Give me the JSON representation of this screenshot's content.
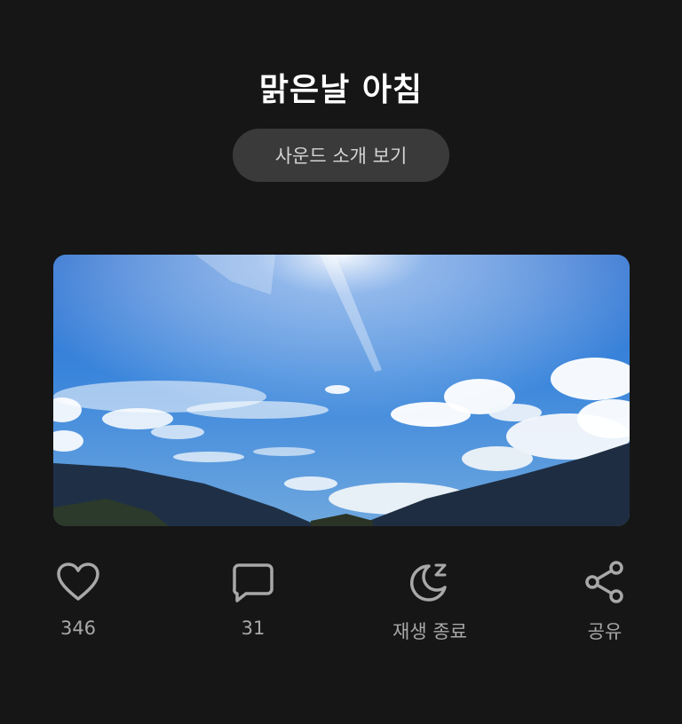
{
  "header": {
    "title": "맑은날 아침",
    "sound_intro_button": "사운드 소개 보기"
  },
  "photo": {
    "description_icon": "sky-landscape-image"
  },
  "actions": {
    "like": {
      "icon": "heart-icon",
      "label": "346"
    },
    "comment": {
      "icon": "comment-icon",
      "label": "31"
    },
    "sleep_timer": {
      "icon": "moon-zzz-icon",
      "label": "재생 종료"
    },
    "share": {
      "icon": "share-icon",
      "label": "공유"
    }
  },
  "colors": {
    "background": "#161616",
    "pill_background": "#3a3a3a",
    "icon_gray": "#a8a8a8"
  }
}
